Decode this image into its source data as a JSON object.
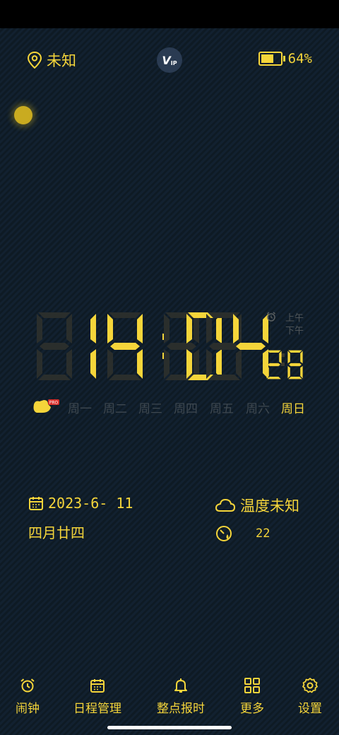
{
  "header": {
    "location": "未知",
    "vip_label": "V",
    "vip_sub": "IP",
    "battery_percent": "64%",
    "battery_level": 0.64
  },
  "clock": {
    "hours": "14",
    "minutes": "04",
    "seconds": "28",
    "am": "上午",
    "pm": "下午"
  },
  "weekdays": {
    "badge": "PRO",
    "items": [
      "周一",
      "周二",
      "周三",
      "周四",
      "周五",
      "周六",
      "周日"
    ],
    "active_index": 6
  },
  "info": {
    "date": "2023-6- 11",
    "lunar": "四月廿四",
    "temperature": "温度未知",
    "humidity": "22"
  },
  "nav": {
    "alarm": "闹钟",
    "schedule": "日程管理",
    "hourly": "整点报时",
    "more": "更多",
    "settings": "设置"
  },
  "colors": {
    "accent": "#f5d53a",
    "inactive": "#3e4850",
    "background": "#0e1a24"
  }
}
